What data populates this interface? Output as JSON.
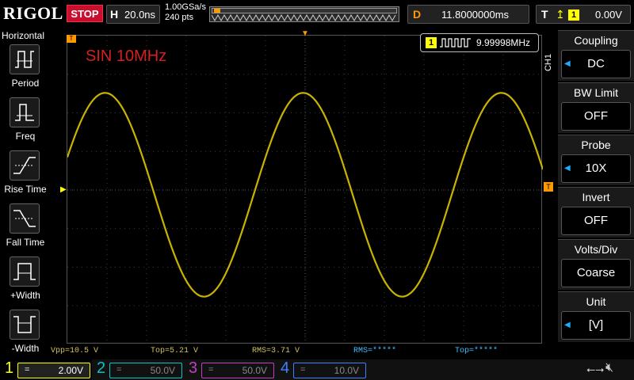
{
  "header": {
    "brand": "RIGOL",
    "run_state": "STOP",
    "timebase_label": "H",
    "timebase_value": "20.0ns",
    "sample_rate": "1.00GSa/s",
    "memory_points": "240 pts",
    "delay_label": "D",
    "delay_value": "11.8000000ms",
    "trigger_label": "T",
    "trigger_edge_icon": "rising-edge-icon",
    "trigger_source": "1",
    "trigger_level": "0.00V"
  },
  "left_menu": {
    "title": "Horizontal",
    "items": [
      {
        "label": "Period",
        "icon": "period-icon"
      },
      {
        "label": "Freq",
        "icon": "freq-icon"
      },
      {
        "label": "Rise Time",
        "icon": "rise-time-icon"
      },
      {
        "label": "Fall Time",
        "icon": "fall-time-icon"
      },
      {
        "label": "+Width",
        "icon": "positive-width-icon"
      },
      {
        "label": "-Width",
        "icon": "negative-width-icon"
      }
    ]
  },
  "display": {
    "annotation": "SIN 10MHz",
    "frequency_channel": "1",
    "frequency_readout": "9.99998MHz",
    "trace_color": "#c8b400",
    "waveform": {
      "shape": "sine",
      "cycles_on_screen": 2.4,
      "amplitude_fraction": 0.33
    }
  },
  "measurements": [
    {
      "text": "Vpp=10.5 V",
      "color": "#d0c060"
    },
    {
      "text": "Top=5.21 V",
      "color": "#d0c060"
    },
    {
      "text": "RMS=3.71 V",
      "color": "#d0c060"
    },
    {
      "text": "RMS=*****",
      "color": "#40c0ff"
    },
    {
      "text": "Top=*****",
      "color": "#40c0ff"
    }
  ],
  "channels": [
    {
      "num": "1",
      "coupling": "=",
      "scale": "2.00V",
      "color": "#ffff00",
      "active": true
    },
    {
      "num": "2",
      "coupling": "=",
      "scale": "50.0V",
      "color": "#00c8c8",
      "active": false
    },
    {
      "num": "3",
      "coupling": "=",
      "scale": "50.0V",
      "color": "#c040c0",
      "active": false
    },
    {
      "num": "4",
      "coupling": "=",
      "scale": "10.0V",
      "color": "#4080ff",
      "active": false
    }
  ],
  "right_menu": {
    "channel_tag": "CH1",
    "items": [
      {
        "title": "Coupling",
        "value": "DC",
        "has_arrow": true
      },
      {
        "title": "BW Limit",
        "value": "OFF",
        "has_arrow": false
      },
      {
        "title": "Probe",
        "value": "10X",
        "has_arrow": true
      },
      {
        "title": "Invert",
        "value": "OFF",
        "has_arrow": false
      },
      {
        "title": "Volts/Div",
        "value": "Coarse",
        "has_arrow": false
      },
      {
        "title": "Unit",
        "value": "[V]",
        "has_arrow": true
      }
    ]
  },
  "status_icons": {
    "usb": "usb-icon",
    "speaker": "speaker-muted-icon"
  }
}
